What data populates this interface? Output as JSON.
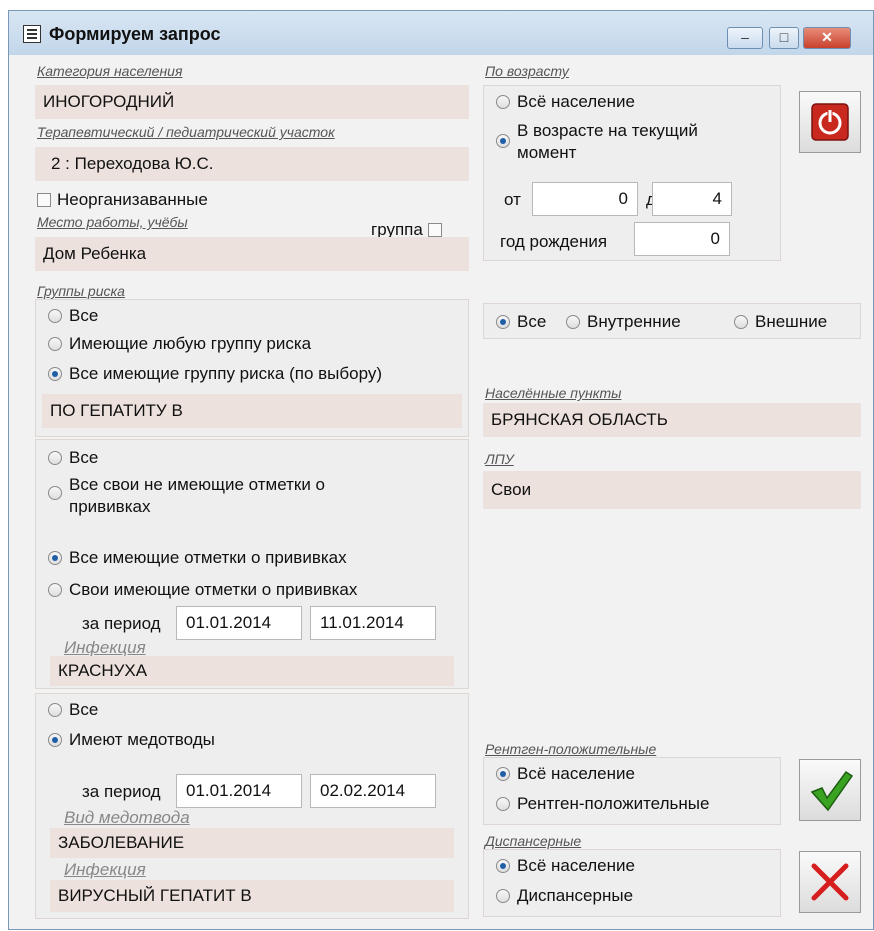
{
  "window": {
    "title": "Формируем запрос",
    "minimize": "‒",
    "maximize": "□",
    "close": "✕"
  },
  "category": {
    "caption": "Категория населения",
    "value": "ИНОГОРОДНИЙ"
  },
  "district": {
    "caption": "Терапевтический / педиатрический участок",
    "value": "2 :  Переходова Ю.С."
  },
  "unorganized": {
    "label": "Неорганизаванные",
    "checked": false
  },
  "workplace": {
    "caption": "Место работы, учёбы",
    "group_label": "группа",
    "value": "Дом Ребенка"
  },
  "risk": {
    "caption": "Группы риска",
    "options": [
      "Все",
      "Имеющие любую группу риска",
      "Все имеющие группу риска (по выбору)"
    ],
    "selected": 2,
    "value": "ПО ГЕПАТИТУ В"
  },
  "vaccinations": {
    "options": [
      "Все",
      "Все свои не имеющие отметки о прививках",
      "Все имеющие отметки о прививках",
      "Свои имеющие отметки о прививках"
    ],
    "selected": 2,
    "period_label": "за период",
    "date_from": "01.01.2014",
    "date_to": "11.01.2014",
    "infection_caption": "Инфекция",
    "infection": "КРАСНУХА"
  },
  "medotvody": {
    "options": [
      "Все",
      "Имеют медотводы"
    ],
    "selected": 1,
    "period_label": "за период",
    "date_from": "01.01.2014",
    "date_to": "02.02.2014",
    "type_caption": "Вид медотвода",
    "type_value": "ЗАБОЛЕВАНИЕ",
    "infection_caption": "Инфекция",
    "infection": "ВИРУСНЫЙ ГЕПАТИТ В"
  },
  "age": {
    "caption": "По возрасту",
    "opt_all": "Всё население",
    "opt_current_line1": "В возрасте на текущий",
    "opt_current_line2": "момент",
    "selected": 1,
    "from_label": "от",
    "from_value": "0",
    "to_label": "до",
    "to_value": "4",
    "birth_label": "год рождения",
    "birth_value": "0"
  },
  "scope": {
    "options": [
      "Все",
      "Внутренние",
      "Внешние"
    ],
    "selected": 0
  },
  "settlements": {
    "caption": "Населённые пункты",
    "value": "БРЯНСКАЯ ОБЛАСТЬ"
  },
  "lpu": {
    "caption": "ЛПУ",
    "value": "Свои"
  },
  "xray": {
    "caption": "Рентген-положительные",
    "options": [
      "Всё население",
      "Рентген-положительные"
    ],
    "selected": 0
  },
  "dispensary": {
    "caption": "Диспансерные",
    "options": [
      "Всё население",
      "Диспансерные"
    ],
    "selected": 0
  },
  "colors": {
    "power": "#c8281e",
    "ok": "#3aa321",
    "cancel": "#d61e1e"
  }
}
